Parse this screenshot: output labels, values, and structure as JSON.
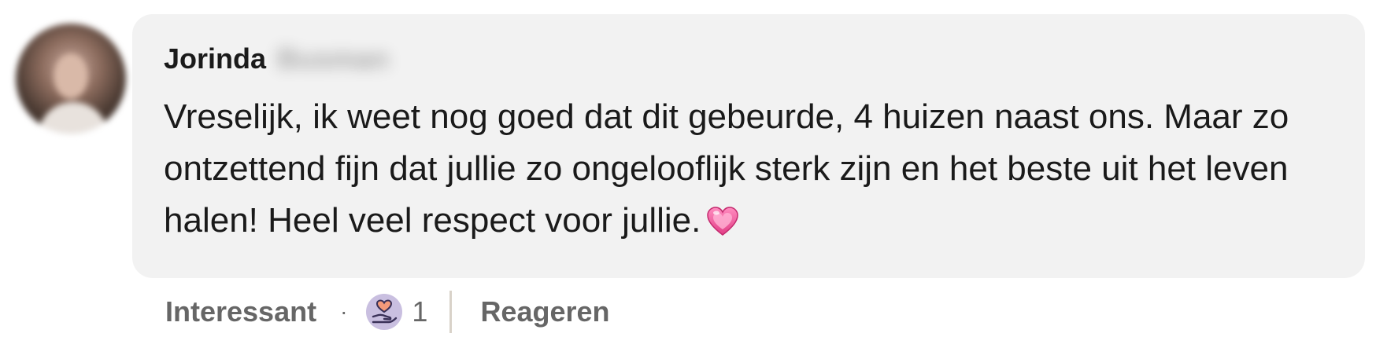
{
  "comment": {
    "author_first_name": "Jorinda",
    "author_last_name": "Busman",
    "text": "Vreselijk, ik weet nog goed dat dit gebeurde, 4 huizen naast ons. Maar zo ontzettend fijn dat jullie zo ongelooflijk sterk zijn en het beste uit het leven halen! Heel veel respect voor jullie.",
    "trailing_emoji_icon": "pink-heart-icon"
  },
  "actions": {
    "interesting_label": "Interessant",
    "separator": "·",
    "reaction_icon": "hand-holding-heart-icon",
    "reaction_count": "1",
    "reply_label": "Reageren"
  },
  "colors": {
    "bubble_background": "#f2f2f2",
    "text_primary": "#1a1a1a",
    "text_secondary": "#666666",
    "reaction_badge": "#c9bfe0",
    "heart_pink": "#f0609a"
  }
}
